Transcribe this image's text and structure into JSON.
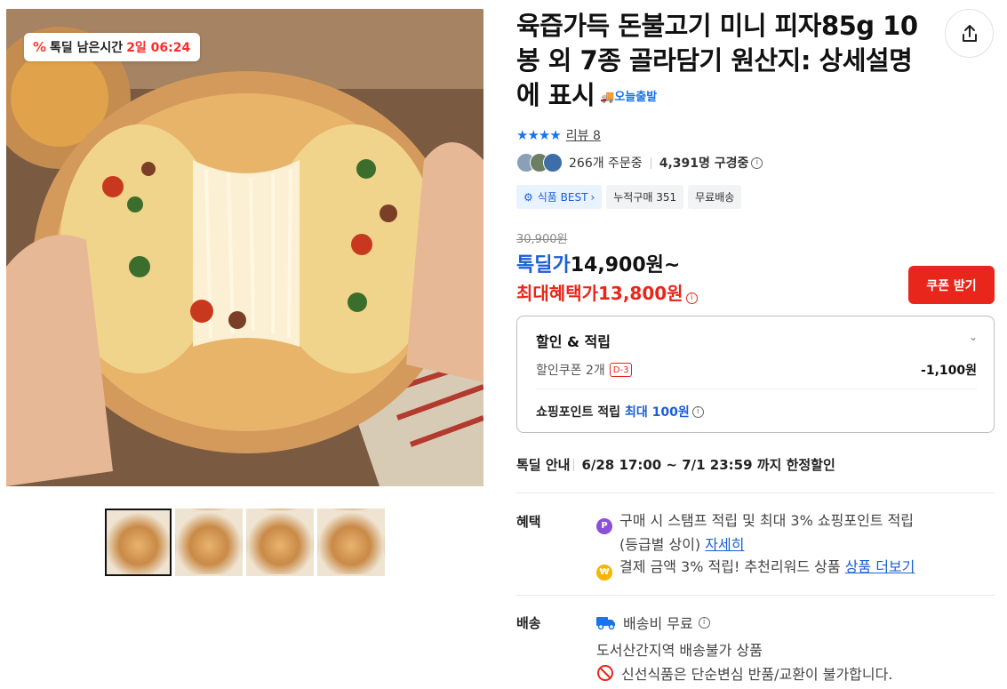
{
  "deal_badge": {
    "icon": "percent-icon",
    "label": "톡딜 남은시간",
    "time": "2일 06:24"
  },
  "product": {
    "title": "육즙가득 돈불고기 미니 피자85g 10봉 외 7종 골라담기 원산지: 상세설명에 표시",
    "fast_delivery_tag": "오늘출발"
  },
  "rating": {
    "stars": "★★★★",
    "review_link": "리뷰 8"
  },
  "stats": {
    "orders": "266개 주문중",
    "viewers": "4,391명 구경중"
  },
  "badges": [
    {
      "label": "식품 BEST"
    },
    {
      "label": "누적구매 351"
    },
    {
      "label": "무료배송"
    }
  ],
  "price": {
    "original": "30,900원",
    "deal_label": "톡딜가",
    "deal_value": "14,900원~",
    "max_label": "최대혜택가",
    "max_value": "13,800원"
  },
  "coupon_button": "쿠폰 받기",
  "discount_box": {
    "title": "할인 & 적립",
    "coupon_label": "할인쿠폰 2개",
    "coupon_dday": "D-3",
    "coupon_amount": "-1,100원",
    "points_label": "쇼핑포인트 적립",
    "points_value": "최대 100원"
  },
  "notice": {
    "label": "톡딜 안내",
    "value": "6/28 17:00 ~ 7/1 23:59 까지 한정할인"
  },
  "benefits": {
    "label": "혜택",
    "line1": "구매 시 스탬프 적립 및 최대 3% 쇼핑포인트 적립",
    "line1b": "(등급별 상이)",
    "line1_link": "자세히",
    "line2": "결제 금액 3% 적립! 추천리워드 상품",
    "line2_link": "상품 더보기"
  },
  "shipping": {
    "label": "배송",
    "fee": "배송비 무료",
    "restriction": "도서산간지역 배송불가 상품",
    "fresh_notice": "신선식품은 단순변심 반품/교환이 불가합니다."
  }
}
